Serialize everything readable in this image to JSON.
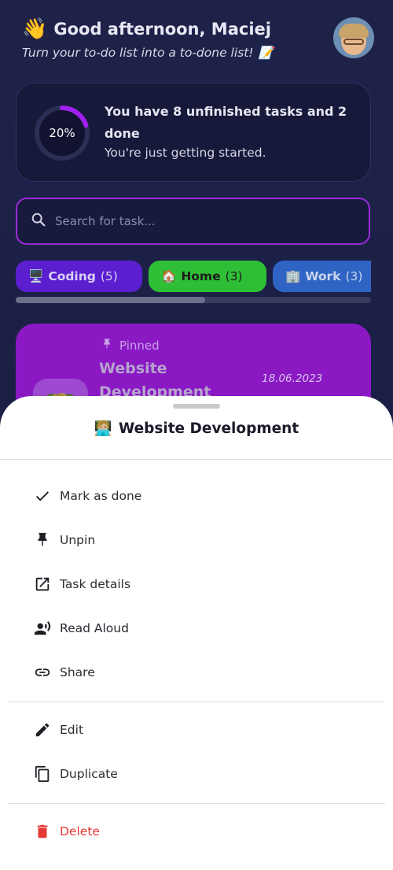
{
  "header": {
    "wave_emoji": "👋",
    "greeting": "Good afternoon, Maciej",
    "subtitle": "Turn your to-do list into a to-done list!",
    "subtitle_emoji": "📝"
  },
  "progress": {
    "percent_label": "20%",
    "percent": 20,
    "title": "You have 8 unfinished tasks and 2 done",
    "message": "You're just getting started.",
    "ring_color": "#a020f0"
  },
  "search": {
    "placeholder": "Search for task..."
  },
  "categories": [
    {
      "emoji": "🖥️",
      "name": "Coding",
      "count": "(5)",
      "color": "#5b1fd0"
    },
    {
      "emoji": "🏠",
      "name": "Home",
      "count": "(3)",
      "color": "#2fbf36"
    },
    {
      "emoji": "🏢",
      "name": "Work",
      "count": "(3)",
      "color": "#2f64c4"
    }
  ],
  "task": {
    "pinned_label": "Pinned",
    "title": "Website Development",
    "date": "18.06.2023",
    "emoji": "🧑🏼‍💻",
    "color": "#8a19c4"
  },
  "sheet": {
    "title_emoji": "🧑🏼‍💻",
    "title": "Website Development",
    "items": [
      {
        "label": "Mark as done",
        "icon": "check-icon"
      },
      {
        "label": "Unpin",
        "icon": "pin-icon"
      },
      {
        "label": "Task details",
        "icon": "open-in-new-icon"
      },
      {
        "label": "Read Aloud",
        "icon": "record-voice-icon"
      },
      {
        "label": "Share",
        "icon": "link-icon"
      },
      {
        "label": "Edit",
        "icon": "pencil-icon"
      },
      {
        "label": "Duplicate",
        "icon": "copy-icon"
      },
      {
        "label": "Delete",
        "icon": "trash-icon"
      }
    ]
  }
}
